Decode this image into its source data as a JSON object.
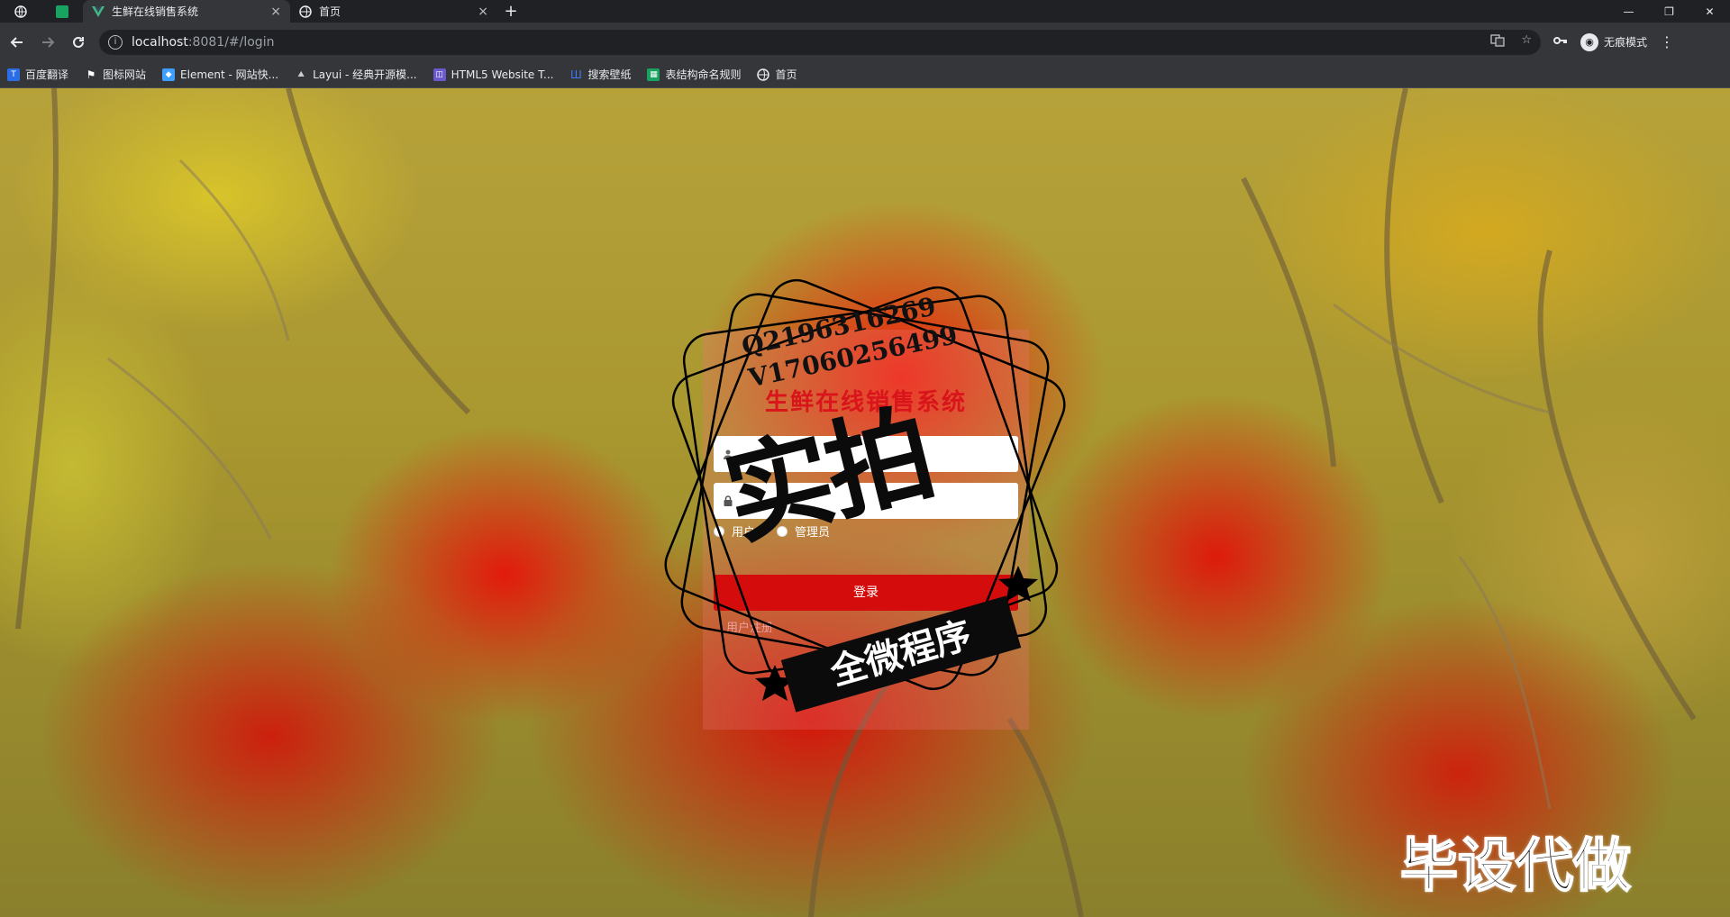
{
  "browser": {
    "tabs": [
      {
        "title": "生鲜在线销售系统",
        "active": true
      },
      {
        "title": "首页",
        "active": false
      }
    ],
    "close_glyph": "×",
    "new_tab_glyph": "+",
    "url_host": "localhost",
    "url_path": ":8081/#/login",
    "profile_label": "无痕模式",
    "bookmarks": [
      {
        "label": "百度翻译",
        "icon": "baidu-translate-icon",
        "color": "#2b6de5"
      },
      {
        "label": "图标网站",
        "icon": "flag-icon",
        "color": "#ffffff"
      },
      {
        "label": "Element - 网站快...",
        "icon": "element-icon",
        "color": "#409eff"
      },
      {
        "label": "Layui - 经典开源模...",
        "icon": "layui-icon",
        "color": "#cccccc"
      },
      {
        "label": "HTML5 Website T...",
        "icon": "html5-template-icon",
        "color": "#6a5acd"
      },
      {
        "label": "搜索壁纸",
        "icon": "wallpaper-icon",
        "color": "#3e7bf5"
      },
      {
        "label": "表结构命名规则",
        "icon": "sheet-icon",
        "color": "#1aa260"
      },
      {
        "label": "首页",
        "icon": "globe-icon",
        "color": "#e8eaed"
      }
    ]
  },
  "login": {
    "title": "生鲜在线销售系统",
    "username_placeholder": "",
    "password_placeholder": "",
    "roles": [
      "用户",
      "管理员"
    ],
    "submit_label": "登录",
    "register_label": "用户注册"
  },
  "watermark": {
    "line1": "Q2196316269",
    "line2": "V17060256499",
    "big_text": "实拍",
    "banner_text": "全微程序",
    "corner_text": "毕设代做"
  },
  "colors": {
    "accent_red": "#d40c0c",
    "title_red": "#d9141b"
  }
}
